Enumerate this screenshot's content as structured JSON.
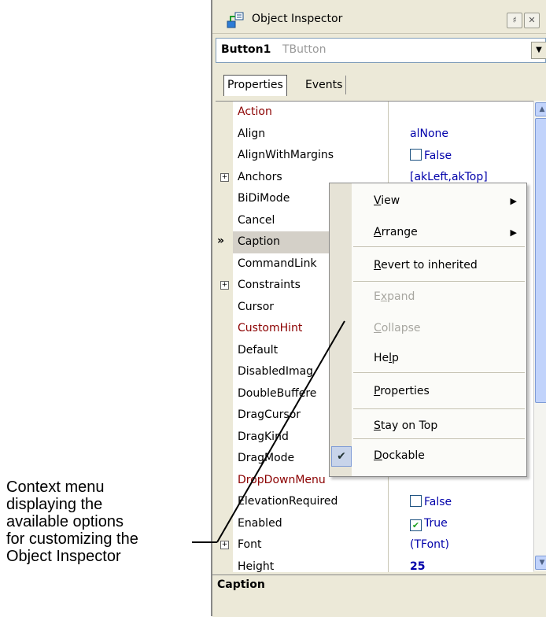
{
  "callout": {
    "lines": [
      "Context menu",
      "displaying the",
      "available options",
      "for customizing the",
      "Object Inspector"
    ]
  },
  "window": {
    "title": "Object Inspector",
    "pin_glyph": "♯",
    "close_glyph": "✕"
  },
  "object_selector": {
    "name": "Button1",
    "type": "TButton",
    "dropdown_glyph": "▼"
  },
  "tabs": [
    "Properties",
    "Events"
  ],
  "properties": [
    {
      "name": "Action",
      "value": "",
      "red": true
    },
    {
      "name": "Align",
      "value": "alNone"
    },
    {
      "name": "AlignWithMargins",
      "value": "False",
      "checkbox": true,
      "checked": false
    },
    {
      "name": "Anchors",
      "value": "[akLeft,akTop]",
      "expandable": true
    },
    {
      "name": "BiDiMode",
      "value": ""
    },
    {
      "name": "Cancel",
      "value": ""
    },
    {
      "name": "Caption",
      "value": "",
      "selected": true
    },
    {
      "name": "CommandLink",
      "value": ""
    },
    {
      "name": "Constraints",
      "value": "",
      "expandable": true
    },
    {
      "name": "Cursor",
      "value": ""
    },
    {
      "name": "CustomHint",
      "value": "",
      "red": true
    },
    {
      "name": "Default",
      "value": ""
    },
    {
      "name": "DisabledImag",
      "value": ""
    },
    {
      "name": "DoubleBuffere",
      "value": ""
    },
    {
      "name": "DragCursor",
      "value": ""
    },
    {
      "name": "DragKind",
      "value": ""
    },
    {
      "name": "DragMode",
      "value": ""
    },
    {
      "name": "DropDownMenu",
      "value": "",
      "red": true
    },
    {
      "name": "ElevationRequired",
      "value": "False",
      "checkbox": true,
      "checked": false
    },
    {
      "name": "Enabled",
      "value": "True",
      "checkbox": true,
      "checked": true
    },
    {
      "name": "Font",
      "value": "(TFont)",
      "expandable": true
    },
    {
      "name": "Height",
      "value": "25",
      "bold": true
    }
  ],
  "selected_marker": "»",
  "status": "Caption",
  "context_menu": {
    "items": [
      {
        "label": "View",
        "underline": "V",
        "submenu": true
      },
      {
        "label": "Arrange",
        "underline": "A",
        "submenu": true
      },
      {
        "label": "Revert to inherited",
        "underline": "R"
      },
      {
        "label": "Expand",
        "underline": "x",
        "disabled": true
      },
      {
        "label": "Collapse",
        "underline": "C",
        "disabled": true
      },
      {
        "label": "Help",
        "underline": "l"
      },
      {
        "label": "Properties",
        "underline": "P"
      },
      {
        "label": "Stay on Top",
        "underline": "S"
      },
      {
        "label": "Dockable",
        "underline": "D",
        "checked": true
      }
    ],
    "submenu_glyph": "▶",
    "check_glyph": "✔"
  },
  "colors": {
    "value_blue": "#0000aa",
    "event_red": "#8b0000",
    "window_bg": "#ece9d8"
  }
}
